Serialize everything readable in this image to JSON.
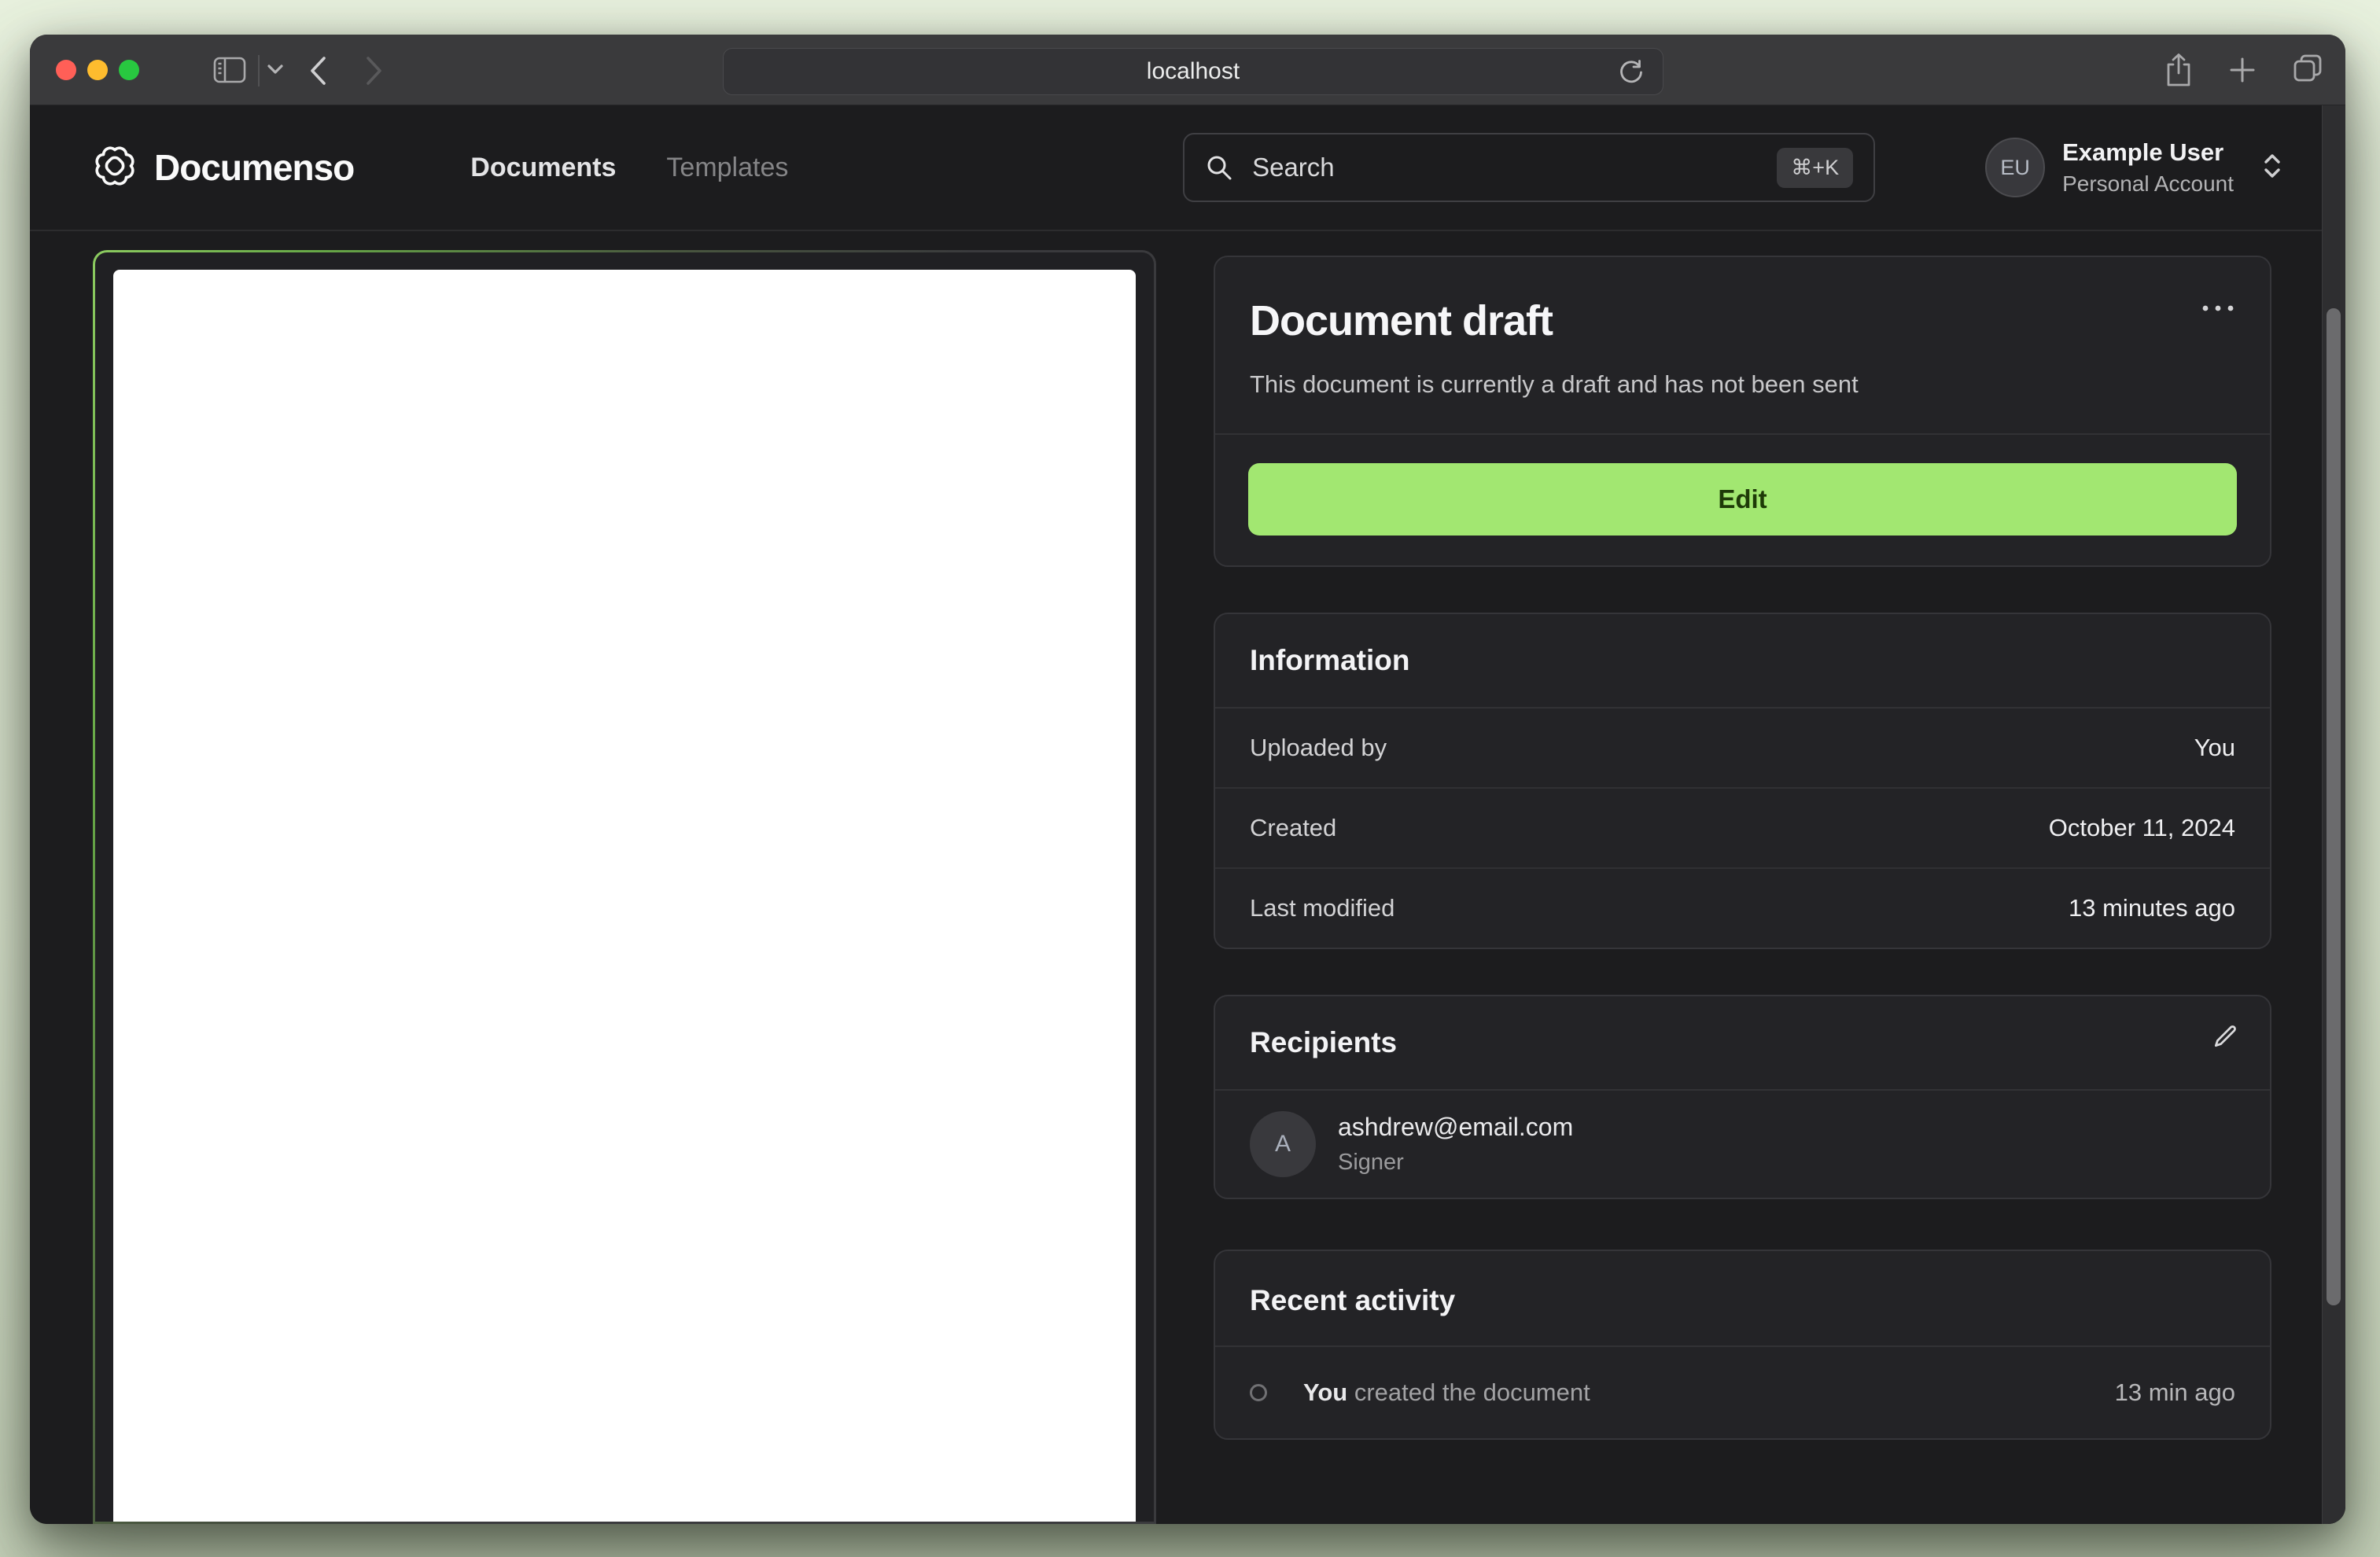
{
  "colors": {
    "accent_green": "#a2e771",
    "edit_text_green": "#1e3a08",
    "traffic_red": "#ff5f57",
    "traffic_yellow": "#febc2e",
    "traffic_green": "#28c840"
  },
  "browser": {
    "url": "localhost",
    "icons": [
      "sidebar-toggle",
      "chevron-down",
      "back",
      "forward",
      "reload",
      "share",
      "new-tab",
      "tab-overview"
    ]
  },
  "header": {
    "brand": "Documenso",
    "nav": [
      {
        "label": "Documents",
        "active": true
      },
      {
        "label": "Templates",
        "active": false
      }
    ],
    "search": {
      "placeholder": "Search",
      "shortcut": "⌘+K"
    },
    "user": {
      "initials": "EU",
      "name": "Example User",
      "account": "Personal Account"
    }
  },
  "draft_card": {
    "title": "Document draft",
    "subtitle": "This document is currently a draft and has not been sent",
    "action": "Edit"
  },
  "information": {
    "title": "Information",
    "rows": [
      {
        "label": "Uploaded by",
        "value": "You"
      },
      {
        "label": "Created",
        "value": "October 11, 2024"
      },
      {
        "label": "Last modified",
        "value": "13 minutes ago"
      }
    ]
  },
  "recipients": {
    "title": "Recipients",
    "items": [
      {
        "initial": "A",
        "email": "ashdrew@email.com",
        "role": "Signer"
      }
    ]
  },
  "activity": {
    "title": "Recent activity",
    "items": [
      {
        "actor": "You",
        "action": " created the document",
        "time": "13 min ago"
      }
    ]
  }
}
